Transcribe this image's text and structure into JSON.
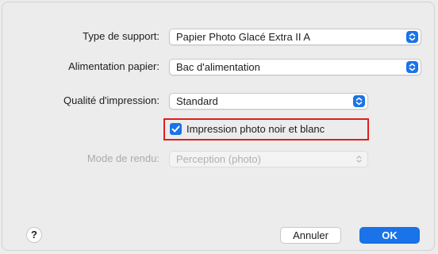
{
  "fields": {
    "media_type": {
      "label": "Type de support:",
      "value": "Papier Photo Glacé Extra II A"
    },
    "paper_source": {
      "label": "Alimentation papier:",
      "value": "Bac d'alimentation"
    },
    "print_quality": {
      "label": "Qualité d'impression:",
      "value": "Standard"
    },
    "grayscale_photo": {
      "label": "Impression photo noir et blanc",
      "checked": true
    },
    "render_mode": {
      "label": "Mode de rendu:",
      "value": "Perception (photo)",
      "disabled": true
    }
  },
  "buttons": {
    "help": "?",
    "cancel": "Annuler",
    "ok": "OK"
  },
  "colors": {
    "accent": "#1a73e8",
    "highlight_box": "#e01e1e"
  }
}
